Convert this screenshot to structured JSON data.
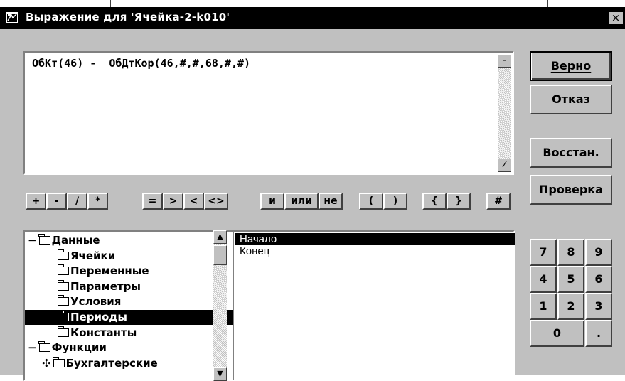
{
  "window": {
    "title": "Выражение для 'Ячейка-2-k010'",
    "close_label": "×"
  },
  "expression": {
    "text": "ОбКт(46) -  ОбДтКор(46,#,#,68,#,#)"
  },
  "buttons": {
    "ok_label": "Верно",
    "cancel_label": "Отказ",
    "restore_label": "Восстан.",
    "check_label": "Проверка"
  },
  "operators": [
    "+",
    "-",
    "/",
    "*",
    "=",
    ">",
    "<",
    "<>",
    "и",
    "или",
    "не",
    "(",
    ")",
    "{",
    "}",
    "#"
  ],
  "tree": {
    "items": [
      {
        "label": "Данные",
        "prefix": "−"
      },
      {
        "label": "Ячейки",
        "prefix": ""
      },
      {
        "label": "Переменные",
        "prefix": ""
      },
      {
        "label": "Параметры",
        "prefix": ""
      },
      {
        "label": "Условия",
        "prefix": ""
      },
      {
        "label": "Периоды",
        "prefix": "",
        "selected": true
      },
      {
        "label": "Константы",
        "prefix": ""
      },
      {
        "label": "Функции",
        "prefix": "−"
      },
      {
        "label": "Бухгалтерские",
        "prefix": "+"
      }
    ]
  },
  "list": {
    "items": [
      "Начало",
      "Конец"
    ],
    "selected_index": 0
  },
  "keypad": {
    "keys": [
      "7",
      "8",
      "9",
      "4",
      "5",
      "6",
      "1",
      "2",
      "3",
      "0",
      "."
    ]
  },
  "icons": {
    "window_icon": "app-window-icon",
    "folder": "folder-icon"
  },
  "colors": {
    "face": "#c0c0c0",
    "title_bg": "#000000",
    "selection": "#000000"
  }
}
